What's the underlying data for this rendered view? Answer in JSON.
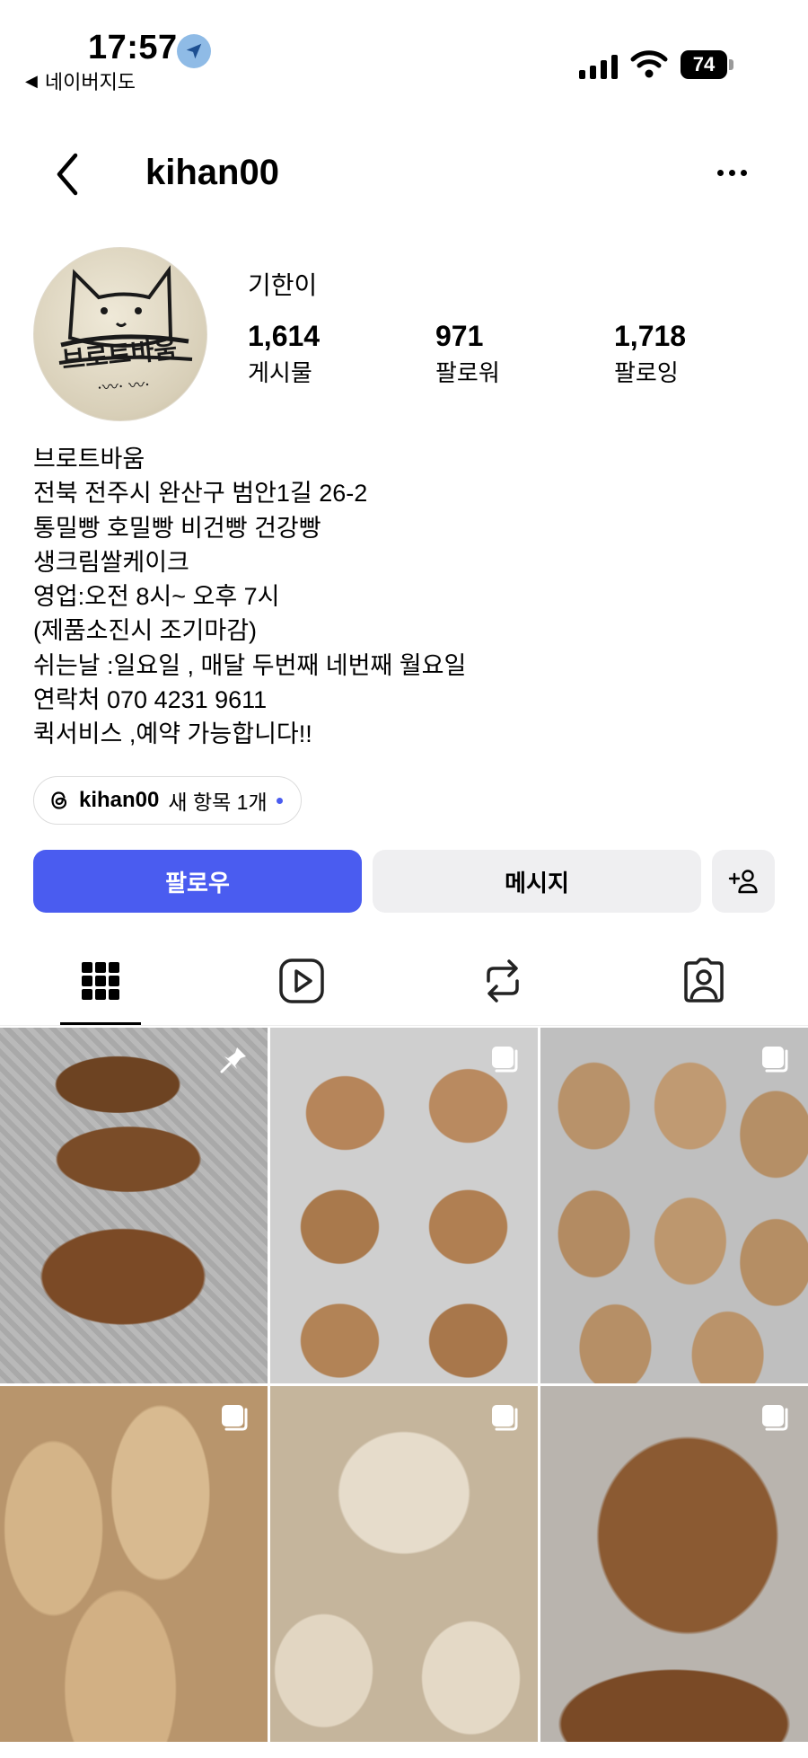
{
  "status_bar": {
    "time": "17:57",
    "back_app": "네이버지도",
    "battery": "74"
  },
  "header": {
    "username": "kihan00"
  },
  "profile": {
    "display_name": "기한이",
    "stats": [
      {
        "value": "1,614",
        "label": "게시물"
      },
      {
        "value": "971",
        "label": "팔로워"
      },
      {
        "value": "1,718",
        "label": "팔로잉"
      }
    ],
    "avatar_text": "브로트바움",
    "bio": [
      "브로트바움",
      "전북 전주시 완산구 범안1길 26-2",
      "통밀빵 호밀빵 비건빵 건강빵",
      "생크림쌀케이크",
      "영업:오전 8시~ 오후 7시",
      "(제품소진시 조기마감)",
      "쉬는날 :일요일 , 매달 두번째 네번째 월요일",
      "연락처 070 4231 9611",
      "퀵서비스 ,예약 가능합니다!!"
    ]
  },
  "threads_chip": {
    "name": "kihan00",
    "text": "새 항목 1개"
  },
  "actions": {
    "follow": "팔로우",
    "message": "메시지"
  },
  "tabs": [
    "grid-icon",
    "reels-icon",
    "reposts-icon",
    "tagged-icon"
  ],
  "colors": {
    "accent": "#4a5cf0",
    "secondary_button": "#efeff1"
  }
}
